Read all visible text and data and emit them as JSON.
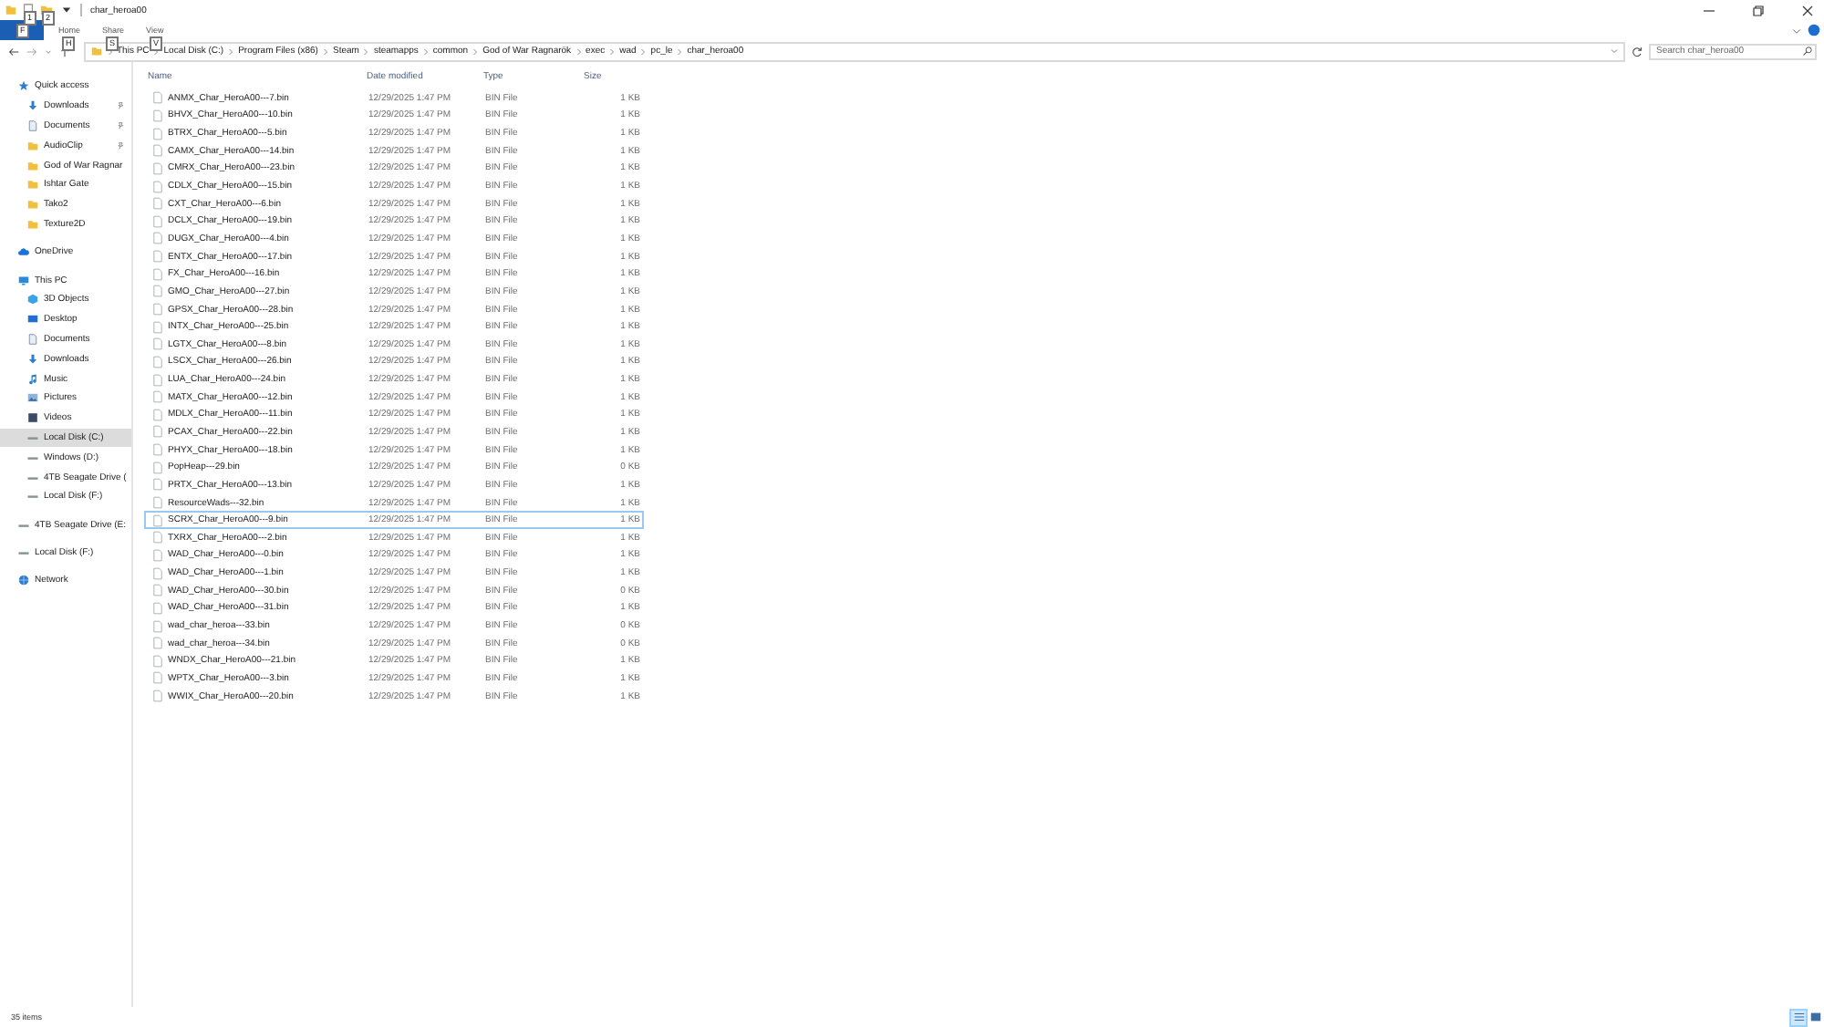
{
  "window": {
    "title": "char_heroa00",
    "quick_access_toolbar": [
      {
        "kind": "properties",
        "key_tip": "1"
      },
      {
        "kind": "new-folder",
        "key_tip": "2"
      }
    ]
  },
  "ribbon": {
    "file_tab": {
      "key_tip": "F"
    },
    "tabs": [
      {
        "label": "Home",
        "key_tip": "H"
      },
      {
        "label": "Share",
        "key_tip": "S"
      },
      {
        "label": "View",
        "key_tip": "V"
      }
    ]
  },
  "address_bar": {
    "crumbs": [
      "This PC",
      "Local Disk (C:)",
      "Program Files (x86)",
      "Steam",
      "steamapps",
      "common",
      "God of War Ragnarök",
      "exec",
      "wad",
      "pc_le",
      "char_heroa00"
    ]
  },
  "search": {
    "placeholder": "Search char_heroa00"
  },
  "sidebar": {
    "items": [
      {
        "label": "Quick access",
        "kind": "star",
        "selected": false,
        "children": [
          {
            "label": "Downloads",
            "kind": "download",
            "pinned": true,
            "selected": false
          },
          {
            "label": "Documents",
            "kind": "document",
            "pinned": true,
            "selected": false
          },
          {
            "label": "AudioClip",
            "kind": "folder",
            "pinned": true,
            "selected": false
          },
          {
            "label": "God of War Ragnar",
            "kind": "folder",
            "pinned": false,
            "selected": false
          },
          {
            "label": "Ishtar Gate",
            "kind": "folder",
            "pinned": false,
            "selected": false
          },
          {
            "label": "Tako2",
            "kind": "folder",
            "pinned": false,
            "selected": false
          },
          {
            "label": "Texture2D",
            "kind": "folder",
            "pinned": false,
            "selected": false
          }
        ]
      },
      {
        "label": "OneDrive",
        "kind": "cloud",
        "selected": false
      },
      {
        "label": "This PC",
        "kind": "pc",
        "selected": false,
        "children": [
          {
            "label": "3D Objects",
            "kind": "cube",
            "pinned": false,
            "selected": false
          },
          {
            "label": "Desktop",
            "kind": "desktop",
            "pinned": false,
            "selected": false
          },
          {
            "label": "Documents",
            "kind": "document",
            "pinned": false,
            "selected": false
          },
          {
            "label": "Downloads",
            "kind": "download",
            "pinned": false,
            "selected": false
          },
          {
            "label": "Music",
            "kind": "music",
            "pinned": false,
            "selected": false
          },
          {
            "label": "Pictures",
            "kind": "picture",
            "pinned": false,
            "selected": false
          },
          {
            "label": "Videos",
            "kind": "video",
            "pinned": false,
            "selected": false
          },
          {
            "label": "Local Disk (C:)",
            "kind": "drive",
            "pinned": false,
            "selected": true
          },
          {
            "label": "Windows (D:)",
            "kind": "drive",
            "pinned": false,
            "selected": false
          },
          {
            "label": "4TB Seagate Drive (",
            "kind": "drive",
            "pinned": false,
            "selected": false
          },
          {
            "label": "Local Disk (F:)",
            "kind": "drive",
            "pinned": false,
            "selected": false
          }
        ]
      },
      {
        "label": "4TB Seagate Drive (E:",
        "kind": "drive",
        "selected": false
      },
      {
        "label": "Local Disk (F:)",
        "kind": "drive",
        "selected": false
      },
      {
        "label": "Network",
        "kind": "network",
        "selected": false
      }
    ]
  },
  "file_list": {
    "columns": [
      "Name",
      "Date modified",
      "Type",
      "Size"
    ],
    "rows": [
      {
        "name": "ANMX_Char_HeroA00---7.bin",
        "date": "12/29/2025 1:47 PM",
        "type": "BIN File",
        "size": "1 KB",
        "focused": false
      },
      {
        "name": "BHVX_Char_HeroA00---10.bin",
        "date": "12/29/2025 1:47 PM",
        "type": "BIN File",
        "size": "1 KB",
        "focused": false
      },
      {
        "name": "BTRX_Char_HeroA00---5.bin",
        "date": "12/29/2025 1:47 PM",
        "type": "BIN File",
        "size": "1 KB",
        "focused": false
      },
      {
        "name": "CAMX_Char_HeroA00---14.bin",
        "date": "12/29/2025 1:47 PM",
        "type": "BIN File",
        "size": "1 KB",
        "focused": false
      },
      {
        "name": "CMRX_Char_HeroA00---23.bin",
        "date": "12/29/2025 1:47 PM",
        "type": "BIN File",
        "size": "1 KB",
        "focused": false
      },
      {
        "name": "CDLX_Char_HeroA00---15.bin",
        "date": "12/29/2025 1:47 PM",
        "type": "BIN File",
        "size": "1 KB",
        "focused": false
      },
      {
        "name": "CXT_Char_HeroA00---6.bin",
        "date": "12/29/2025 1:47 PM",
        "type": "BIN File",
        "size": "1 KB",
        "focused": false
      },
      {
        "name": "DCLX_Char_HeroA00---19.bin",
        "date": "12/29/2025 1:47 PM",
        "type": "BIN File",
        "size": "1 KB",
        "focused": false
      },
      {
        "name": "DUGX_Char_HeroA00---4.bin",
        "date": "12/29/2025 1:47 PM",
        "type": "BIN File",
        "size": "1 KB",
        "focused": false
      },
      {
        "name": "ENTX_Char_HeroA00---17.bin",
        "date": "12/29/2025 1:47 PM",
        "type": "BIN File",
        "size": "1 KB",
        "focused": false
      },
      {
        "name": "FX_Char_HeroA00---16.bin",
        "date": "12/29/2025 1:47 PM",
        "type": "BIN File",
        "size": "1 KB",
        "focused": false
      },
      {
        "name": "GMO_Char_HeroA00---27.bin",
        "date": "12/29/2025 1:47 PM",
        "type": "BIN File",
        "size": "1 KB",
        "focused": false
      },
      {
        "name": "GPSX_Char_HeroA00---28.bin",
        "date": "12/29/2025 1:47 PM",
        "type": "BIN File",
        "size": "1 KB",
        "focused": false
      },
      {
        "name": "INTX_Char_HeroA00---25.bin",
        "date": "12/29/2025 1:47 PM",
        "type": "BIN File",
        "size": "1 KB",
        "focused": false
      },
      {
        "name": "LGTX_Char_HeroA00---8.bin",
        "date": "12/29/2025 1:47 PM",
        "type": "BIN File",
        "size": "1 KB",
        "focused": false
      },
      {
        "name": "LSCX_Char_HeroA00---26.bin",
        "date": "12/29/2025 1:47 PM",
        "type": "BIN File",
        "size": "1 KB",
        "focused": false
      },
      {
        "name": "LUA_Char_HeroA00---24.bin",
        "date": "12/29/2025 1:47 PM",
        "type": "BIN File",
        "size": "1 KB",
        "focused": false
      },
      {
        "name": "MATX_Char_HeroA00---12.bin",
        "date": "12/29/2025 1:47 PM",
        "type": "BIN File",
        "size": "1 KB",
        "focused": false
      },
      {
        "name": "MDLX_Char_HeroA00---11.bin",
        "date": "12/29/2025 1:47 PM",
        "type": "BIN File",
        "size": "1 KB",
        "focused": false
      },
      {
        "name": "PCAX_Char_HeroA00---22.bin",
        "date": "12/29/2025 1:47 PM",
        "type": "BIN File",
        "size": "1 KB",
        "focused": false
      },
      {
        "name": "PHYX_Char_HeroA00---18.bin",
        "date": "12/29/2025 1:47 PM",
        "type": "BIN File",
        "size": "1 KB",
        "focused": false
      },
      {
        "name": "PopHeap---29.bin",
        "date": "12/29/2025 1:47 PM",
        "type": "BIN File",
        "size": "0 KB",
        "focused": false
      },
      {
        "name": "PRTX_Char_HeroA00---13.bin",
        "date": "12/29/2025 1:47 PM",
        "type": "BIN File",
        "size": "1 KB",
        "focused": false
      },
      {
        "name": "ResourceWads---32.bin",
        "date": "12/29/2025 1:47 PM",
        "type": "BIN File",
        "size": "1 KB",
        "focused": false
      },
      {
        "name": "SCRX_Char_HeroA00---9.bin",
        "date": "12/29/2025 1:47 PM",
        "type": "BIN File",
        "size": "1 KB",
        "focused": true
      },
      {
        "name": "TXRX_Char_HeroA00---2.bin",
        "date": "12/29/2025 1:47 PM",
        "type": "BIN File",
        "size": "1 KB",
        "focused": false
      },
      {
        "name": "WAD_Char_HeroA00---0.bin",
        "date": "12/29/2025 1:47 PM",
        "type": "BIN File",
        "size": "1 KB",
        "focused": false
      },
      {
        "name": "WAD_Char_HeroA00---1.bin",
        "date": "12/29/2025 1:47 PM",
        "type": "BIN File",
        "size": "1 KB",
        "focused": false
      },
      {
        "name": "WAD_Char_HeroA00---30.bin",
        "date": "12/29/2025 1:47 PM",
        "type": "BIN File",
        "size": "0 KB",
        "focused": false
      },
      {
        "name": "WAD_Char_HeroA00---31.bin",
        "date": "12/29/2025 1:47 PM",
        "type": "BIN File",
        "size": "1 KB",
        "focused": false
      },
      {
        "name": "wad_char_heroa---33.bin",
        "date": "12/29/2025 1:47 PM",
        "type": "BIN File",
        "size": "0 KB",
        "focused": false
      },
      {
        "name": "wad_char_heroa---34.bin",
        "date": "12/29/2025 1:47 PM",
        "type": "BIN File",
        "size": "0 KB",
        "focused": false
      },
      {
        "name": "WNDX_Char_HeroA00---21.bin",
        "date": "12/29/2025 1:47 PM",
        "type": "BIN File",
        "size": "1 KB",
        "focused": false
      },
      {
        "name": "WPTX_Char_HeroA00---3.bin",
        "date": "12/29/2025 1:47 PM",
        "type": "BIN File",
        "size": "1 KB",
        "focused": false
      },
      {
        "name": "WWIX_Char_HeroA00---20.bin",
        "date": "12/29/2025 1:47 PM",
        "type": "BIN File",
        "size": "1 KB",
        "focused": false
      }
    ]
  },
  "status_bar": {
    "item_count": "35 items",
    "views": [
      {
        "kind": "details",
        "selected": true
      },
      {
        "kind": "large-icons",
        "selected": false
      }
    ]
  }
}
